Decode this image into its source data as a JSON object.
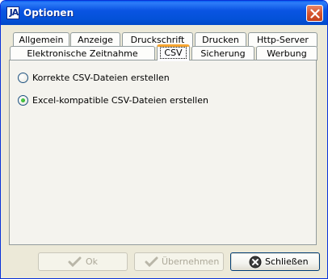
{
  "window": {
    "title": "Optionen",
    "app_icon_glyph": "JA"
  },
  "tabs": {
    "row1": [
      "Allgemein",
      "Anzeige",
      "Druckschrift",
      "Drucken",
      "Http-Server"
    ],
    "row2": [
      "Elektronische Zeitnahme",
      "CSV",
      "Sicherung",
      "Werbung"
    ],
    "selected": "CSV"
  },
  "panel": {
    "options": [
      {
        "label": "Korrekte CSV-Dateien erstellen",
        "selected": false
      },
      {
        "label": "Excel-kompatible CSV-Dateien erstellen",
        "selected": true
      }
    ]
  },
  "buttons": {
    "ok": {
      "label": "Ok",
      "enabled": false,
      "icon": "checkmark-icon"
    },
    "apply": {
      "label": "Übernehmen",
      "enabled": false,
      "icon": "checkmark-icon"
    },
    "close": {
      "label": "Schließen",
      "enabled": true,
      "icon": "close-circle-icon"
    }
  },
  "colors": {
    "title_bar": "#0a54e3",
    "tab_highlight": "#f7a530",
    "radio_selected": "#21a121"
  }
}
